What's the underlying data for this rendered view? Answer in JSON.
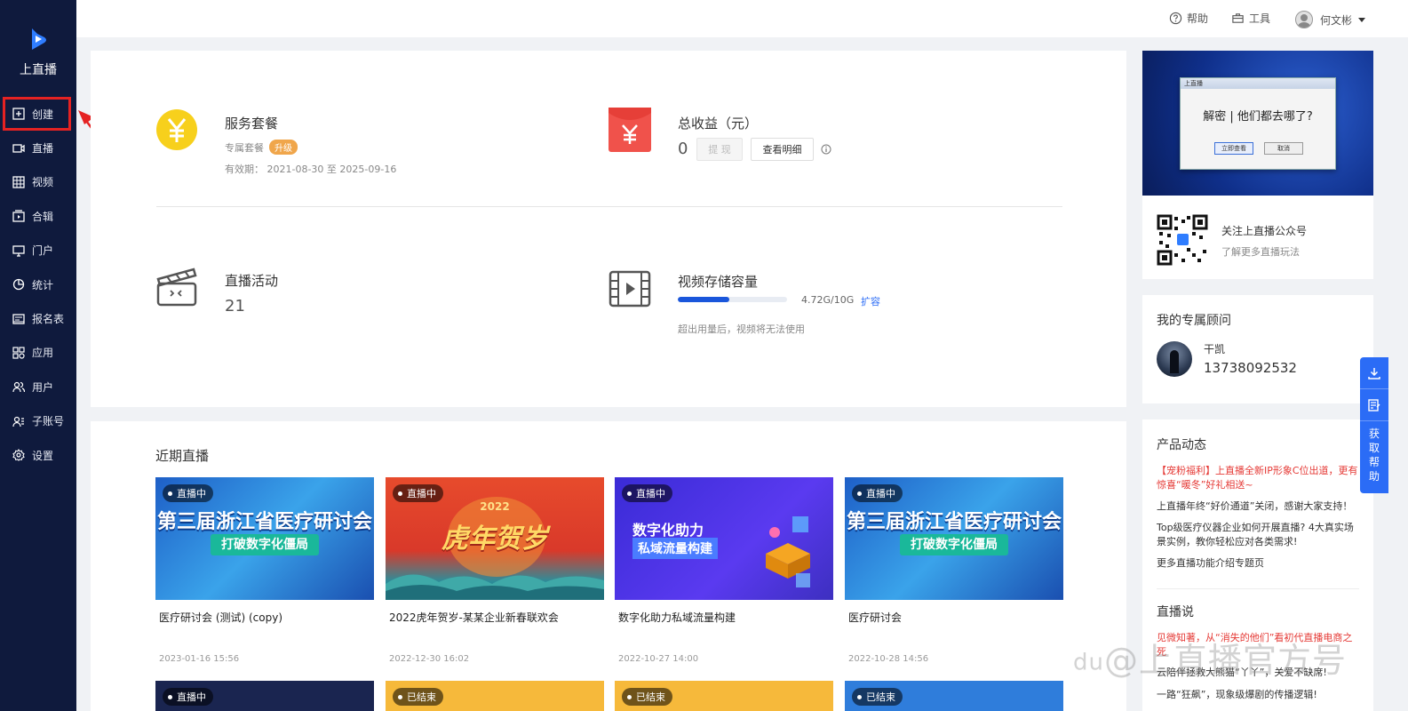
{
  "brand": {
    "name": "上直播"
  },
  "sidebar": {
    "items": [
      {
        "label": "创建",
        "icon": "plus-square-icon"
      },
      {
        "label": "直播",
        "icon": "video-camera-icon"
      },
      {
        "label": "视频",
        "icon": "film-icon"
      },
      {
        "label": "合辑",
        "icon": "collection-icon"
      },
      {
        "label": "门户",
        "icon": "monitor-icon"
      },
      {
        "label": "统计",
        "icon": "pie-chart-icon"
      },
      {
        "label": "报名表",
        "icon": "form-icon"
      },
      {
        "label": "应用",
        "icon": "apps-icon"
      },
      {
        "label": "用户",
        "icon": "users-icon"
      },
      {
        "label": "子账号",
        "icon": "sub-account-icon"
      },
      {
        "label": "设置",
        "icon": "gear-icon"
      }
    ]
  },
  "header": {
    "help": "帮助",
    "tools": "工具",
    "user": "何文彬"
  },
  "service": {
    "title": "服务套餐",
    "plan": "专属套餐",
    "upgrade": "升级",
    "validity": "有效期：  2021-08-30 至 2025-09-16"
  },
  "income": {
    "title": "总收益（元）",
    "value": "0",
    "withdraw": "提 现",
    "detail": "查看明细"
  },
  "activity": {
    "title": "直播活动",
    "value": "21"
  },
  "storage": {
    "title": "视频存储容量",
    "used": "4.72G/10G",
    "used_fraction": 0.472,
    "expand": "扩容",
    "note": "超出用量后，视频将无法使用"
  },
  "recent": {
    "title": "近期直播",
    "cards": [
      {
        "badge": "直播中",
        "title": "医疗研讨会 (测试) (copy)",
        "time": "2023-01-16 15:56",
        "h1": "第三届浙江省医疗研讨会",
        "h2": "打破数字化僵局"
      },
      {
        "badge": "直播中",
        "title": "2022虎年贺岁-某某企业新春联欢会",
        "time": "2022-12-30 16:02",
        "h1": "虎年贺岁",
        "h2": "2022"
      },
      {
        "badge": "直播中",
        "title": "数字化助力私域流量构建",
        "time": "2022-10-27 14:00",
        "h1": "数字化助力",
        "h2": "私域流量构建"
      },
      {
        "badge": "直播中",
        "title": "医疗研讨会",
        "time": "2022-10-28 14:56",
        "h1": "第三届浙江省医疗研讨会",
        "h2": "打破数字化僵局"
      }
    ],
    "row2_badges": [
      "直播中",
      "已结束",
      "已结束",
      "已结束"
    ]
  },
  "right": {
    "banner": {
      "dialog_title": "上直播",
      "text": "解密 | 他们都去哪了?",
      "ok": "立即查看",
      "cancel": "取消"
    },
    "follow": {
      "title": "关注上直播公众号",
      "sub": "了解更多直播玩法"
    },
    "advisor": {
      "title": "我的专属顾问",
      "name": "干凯",
      "phone": "13738092532"
    },
    "product_news": {
      "title": "产品动态",
      "items": [
        "【宠粉福利】上直播全新IP形象C位出道，更有惊喜“暖冬”好礼相送~",
        "上直播年终“好价通道”关闭，感谢大家支持！",
        "Top级医疗仪器企业如何开展直播? 4大真实场景实例，教你轻松应对各类需求!",
        "更多直播功能介绍专题页"
      ]
    },
    "live_talk": {
      "title": "直播说",
      "items": [
        "见微知著，从“消失的他们”看初代直播电商之死",
        "云陪伴拯救大熊猫“丫丫”，关爱不缺席!",
        "一路“狂飙”，现象级爆剧的传播逻辑!"
      ]
    }
  },
  "float_bar": {
    "text": "获取帮助"
  },
  "watermark": "@上直播官方号"
}
